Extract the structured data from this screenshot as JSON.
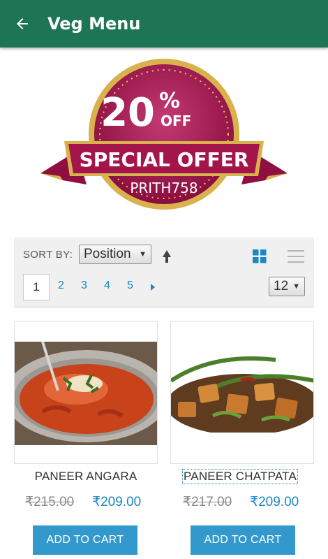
{
  "app_bar": {
    "title": "Veg Menu"
  },
  "banner": {
    "percent": "20",
    "percent_sign": "%",
    "off": "OFF",
    "headline": "SPECIAL OFFER",
    "code": "PRITH758"
  },
  "toolbar": {
    "sort_label": "SORT BY:",
    "sort_value": "Position",
    "pages": [
      "1",
      "2",
      "3",
      "4",
      "5"
    ],
    "limit_value": "12"
  },
  "products": [
    {
      "name": "PANEER ANGARA",
      "old_price": "₹215.00",
      "price": "₹209.00",
      "button": "ADD TO CART"
    },
    {
      "name": "PANEER CHATPATA",
      "old_price": "₹217.00",
      "price": "₹209.00",
      "button": "ADD TO CART"
    }
  ],
  "colors": {
    "app_bar": "#1e7556",
    "accent": "#1a87c6",
    "button": "#3399cc",
    "badge": "#a4154c",
    "gold": "#d8b24c"
  },
  "icons": {
    "back": "arrow-left-icon",
    "sort": "arrow-up-icon",
    "grid": "grid-icon",
    "list": "list-icon",
    "next": "caret-right-icon"
  }
}
